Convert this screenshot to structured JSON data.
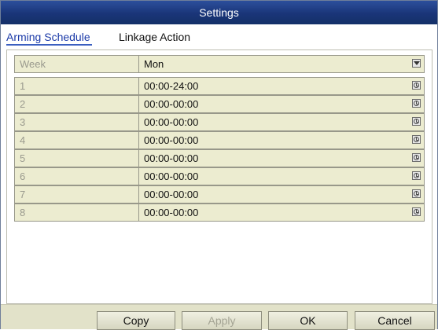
{
  "window": {
    "title": "Settings"
  },
  "tabs": [
    {
      "label": "Arming Schedule",
      "active": true
    },
    {
      "label": "Linkage Action",
      "active": false
    }
  ],
  "week": {
    "label": "Week",
    "selected": "Mon"
  },
  "schedule": [
    {
      "index": "1",
      "time": "00:00-24:00"
    },
    {
      "index": "2",
      "time": "00:00-00:00"
    },
    {
      "index": "3",
      "time": "00:00-00:00"
    },
    {
      "index": "4",
      "time": "00:00-00:00"
    },
    {
      "index": "5",
      "time": "00:00-00:00"
    },
    {
      "index": "6",
      "time": "00:00-00:00"
    },
    {
      "index": "7",
      "time": "00:00-00:00"
    },
    {
      "index": "8",
      "time": "00:00-00:00"
    }
  ],
  "buttons": {
    "copy": "Copy",
    "apply": "Apply",
    "ok": "OK",
    "cancel": "Cancel"
  },
  "icons": {
    "dropdown": "chevron-down-icon",
    "time_picker": "clock-icon"
  },
  "colors": {
    "title_bar": "#1a3578",
    "row_bg": "#ececd0",
    "footer_bg": "#e2e2c9",
    "active_tab": "#1b3aa8"
  },
  "states": {
    "apply_enabled": false
  }
}
